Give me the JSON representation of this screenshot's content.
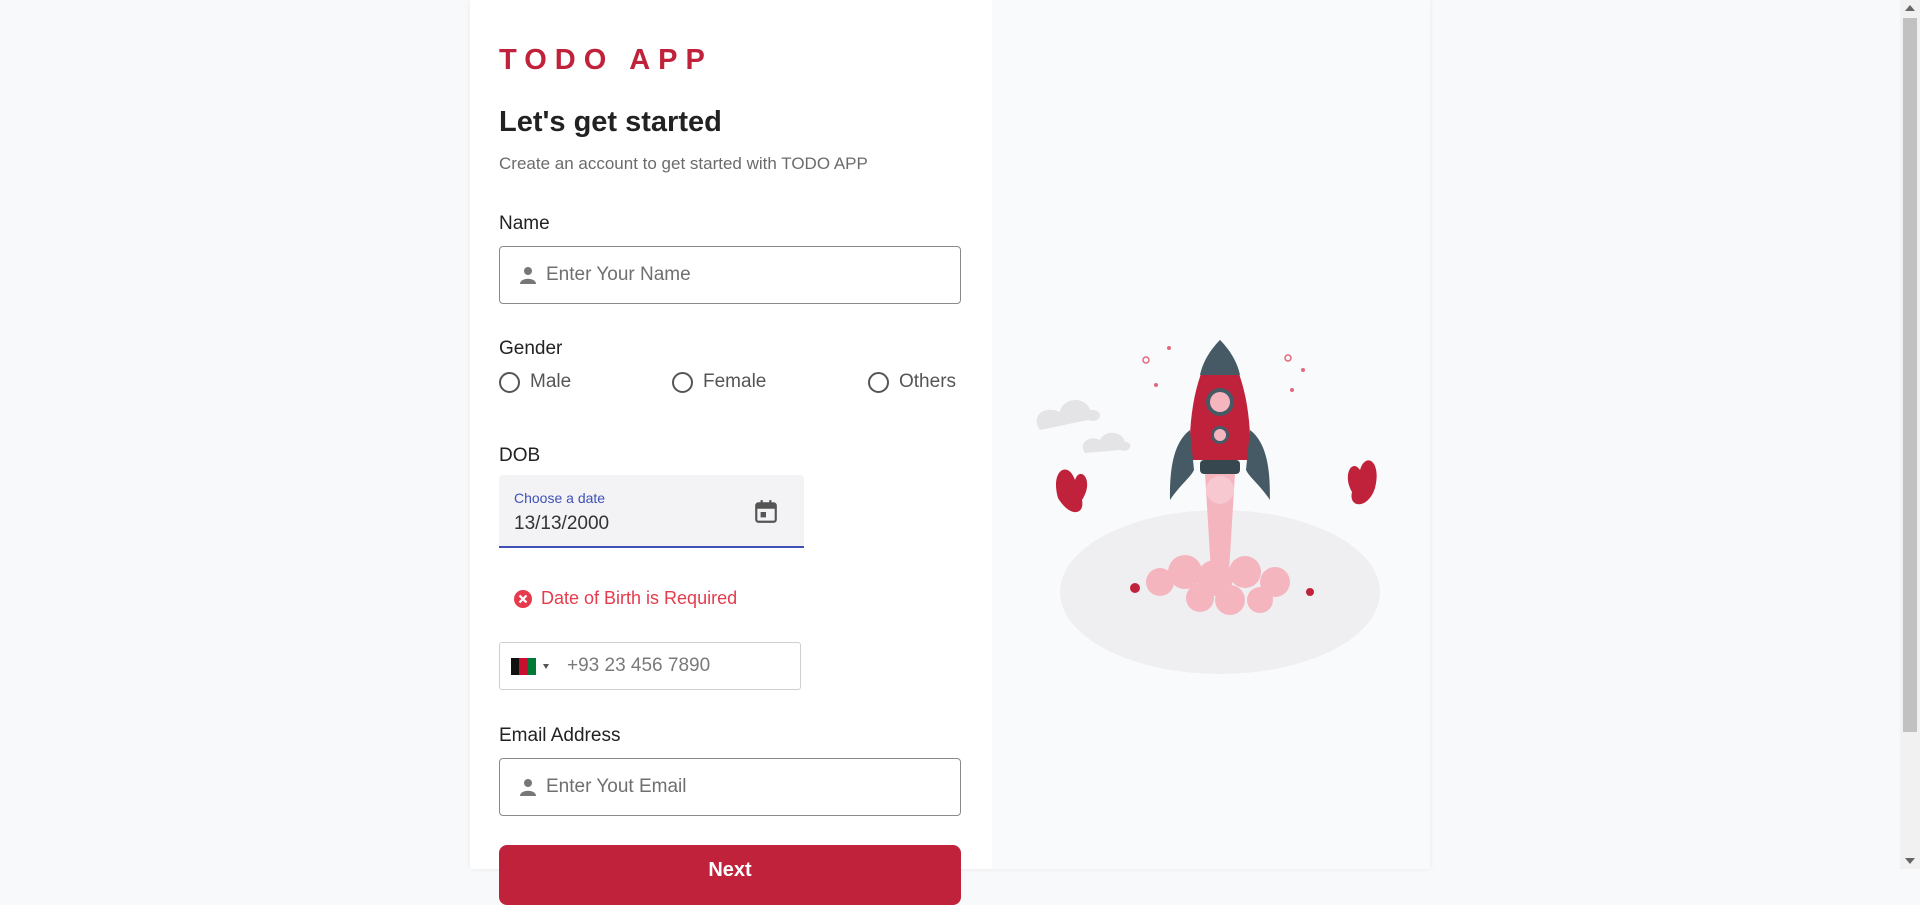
{
  "brand": {
    "name": "TODO APP"
  },
  "header": {
    "title": "Let's get started",
    "subtitle": "Create an account to get started with TODO APP"
  },
  "form": {
    "name": {
      "label": "Name",
      "placeholder": "Enter Your Name",
      "icon": "user-icon"
    },
    "gender": {
      "label": "Gender",
      "options": [
        "Male",
        "Female",
        "Others"
      ]
    },
    "dob": {
      "label": "DOB",
      "floating_label": "Choose a date",
      "value": "13/13/2000",
      "icon": "calendar-icon",
      "error": "Date of Birth is Required"
    },
    "phone": {
      "placeholder": "+93 23 456 7890",
      "country_flag": "afghanistan-flag-icon"
    },
    "email": {
      "label": "Email Address",
      "placeholder": "Enter Yout Email",
      "icon": "user-icon"
    },
    "submit": {
      "label": "Next"
    }
  },
  "colors": {
    "brand": "#c1223b",
    "error": "#e53b4c",
    "focus": "#3f51b5"
  }
}
